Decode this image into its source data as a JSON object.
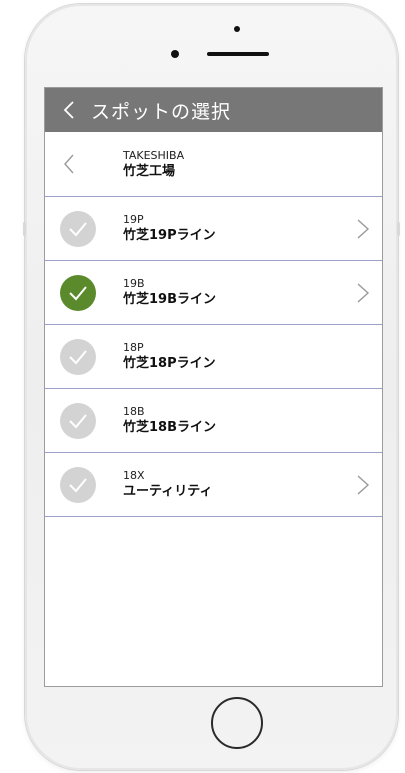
{
  "header": {
    "title": "スポットの選択"
  },
  "spot": {
    "code": "TAKESHIBA",
    "name": "竹芝工場"
  },
  "lines": [
    {
      "code": "19P",
      "name": "竹芝19Pライン",
      "selected": false,
      "has_chevron": true
    },
    {
      "code": "19B",
      "name": "竹芝19Bライン",
      "selected": true,
      "has_chevron": true
    },
    {
      "code": "18P",
      "name": "竹芝18Pライン",
      "selected": false,
      "has_chevron": false
    },
    {
      "code": "18B",
      "name": "竹芝18Bライン",
      "selected": false,
      "has_chevron": false
    },
    {
      "code": "18X",
      "name": "ユーティリティ",
      "selected": false,
      "has_chevron": true
    }
  ],
  "icons": {
    "header_back": "chevron-left-icon",
    "spot_back": "chevron-left-icon",
    "check": "checkmark-icon",
    "row_chevron": "chevron-right-icon"
  },
  "colors": {
    "header_bg": "#777777",
    "selected_check": "#5a8a2b",
    "unselected_check": "#d3d3d3",
    "divider": "#9aa0c8"
  }
}
